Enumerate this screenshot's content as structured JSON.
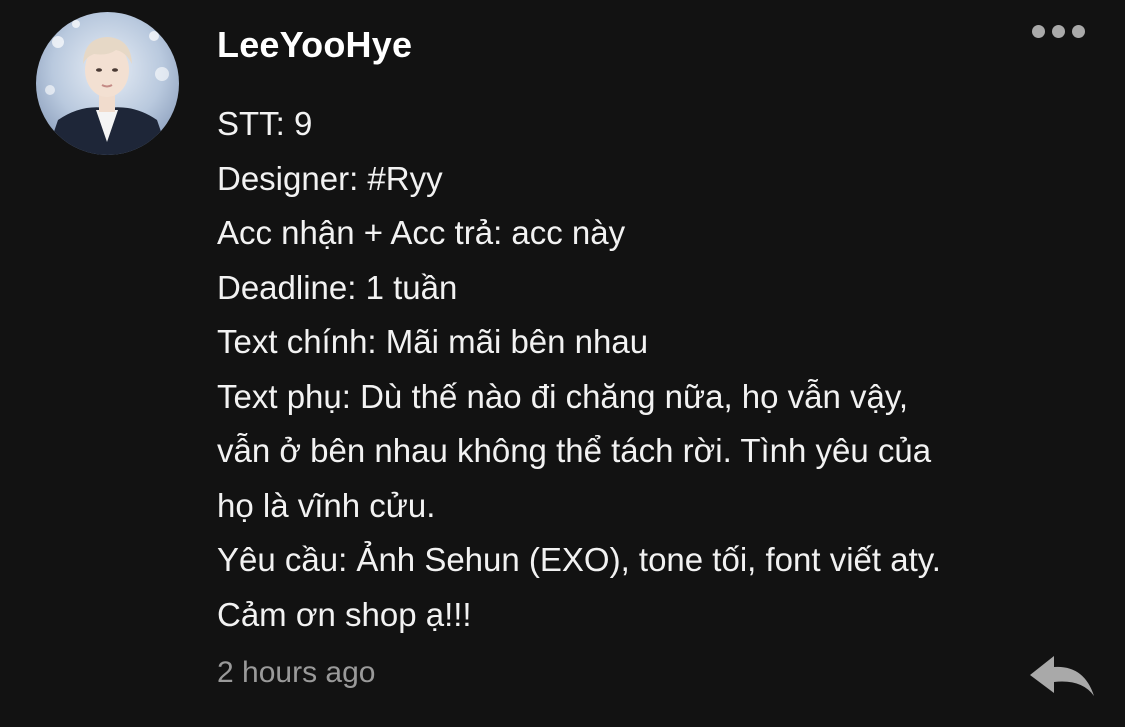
{
  "comment": {
    "username": "LeeYooHye",
    "avatar_icon": "user-avatar-photo",
    "more_icon": "more-horizontal-icon",
    "lines": [
      "STT: 9",
      "Designer: #Ryy",
      "Acc nhận + Acc trả: acc này",
      "Deadline: 1 tuần",
      "Text chính: Mãi mãi bên nhau",
      "Text phụ: Dù thế nào đi chăng nữa, họ vẫn vậy,",
      "vẫn ở bên nhau không thể tách rời. Tình yêu của",
      "họ là vĩnh cửu.",
      "Yêu cầu: Ảnh Sehun (EXO), tone tối, font viết aty.",
      "Cảm ơn shop ạ!!!"
    ],
    "timestamp": "2 hours ago",
    "reply_icon": "reply-arrow-icon"
  },
  "colors": {
    "background": "#121212",
    "text": "#f2f2f2",
    "muted": "#9a9a9a",
    "icon": "#a9a9a9"
  }
}
